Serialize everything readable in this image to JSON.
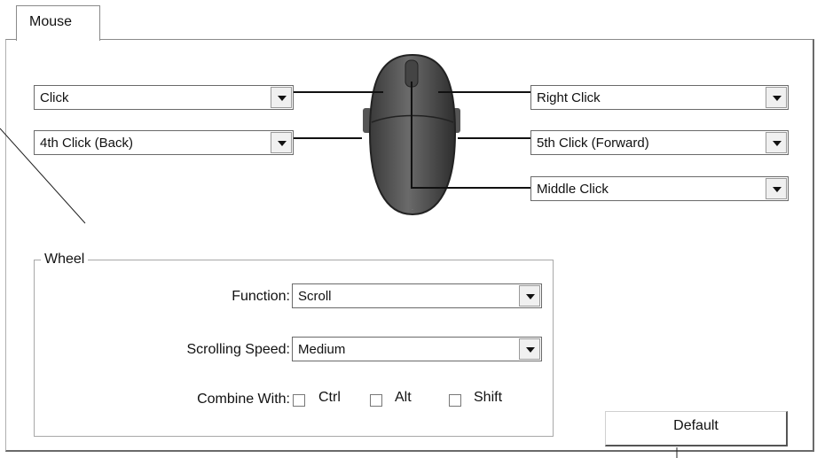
{
  "tab": {
    "label": "Mouse"
  },
  "buttons": {
    "left": "Click",
    "right": "Right Click",
    "fourth": "4th Click (Back)",
    "fifth": "5th Click (Forward)",
    "middle": "Middle Click"
  },
  "wheel": {
    "group_label": "Wheel",
    "function_label": "Function:",
    "function_value": "Scroll",
    "speed_label": "Scrolling Speed:",
    "speed_value": "Medium",
    "combine_label": "Combine With:",
    "modifiers": [
      {
        "label": "Ctrl",
        "checked": false
      },
      {
        "label": "Alt",
        "checked": false
      },
      {
        "label": "Shift",
        "checked": false
      }
    ]
  },
  "default_button": "Default",
  "icons": [
    "dropdown-arrow-icon",
    "mouse-image-icon"
  ]
}
